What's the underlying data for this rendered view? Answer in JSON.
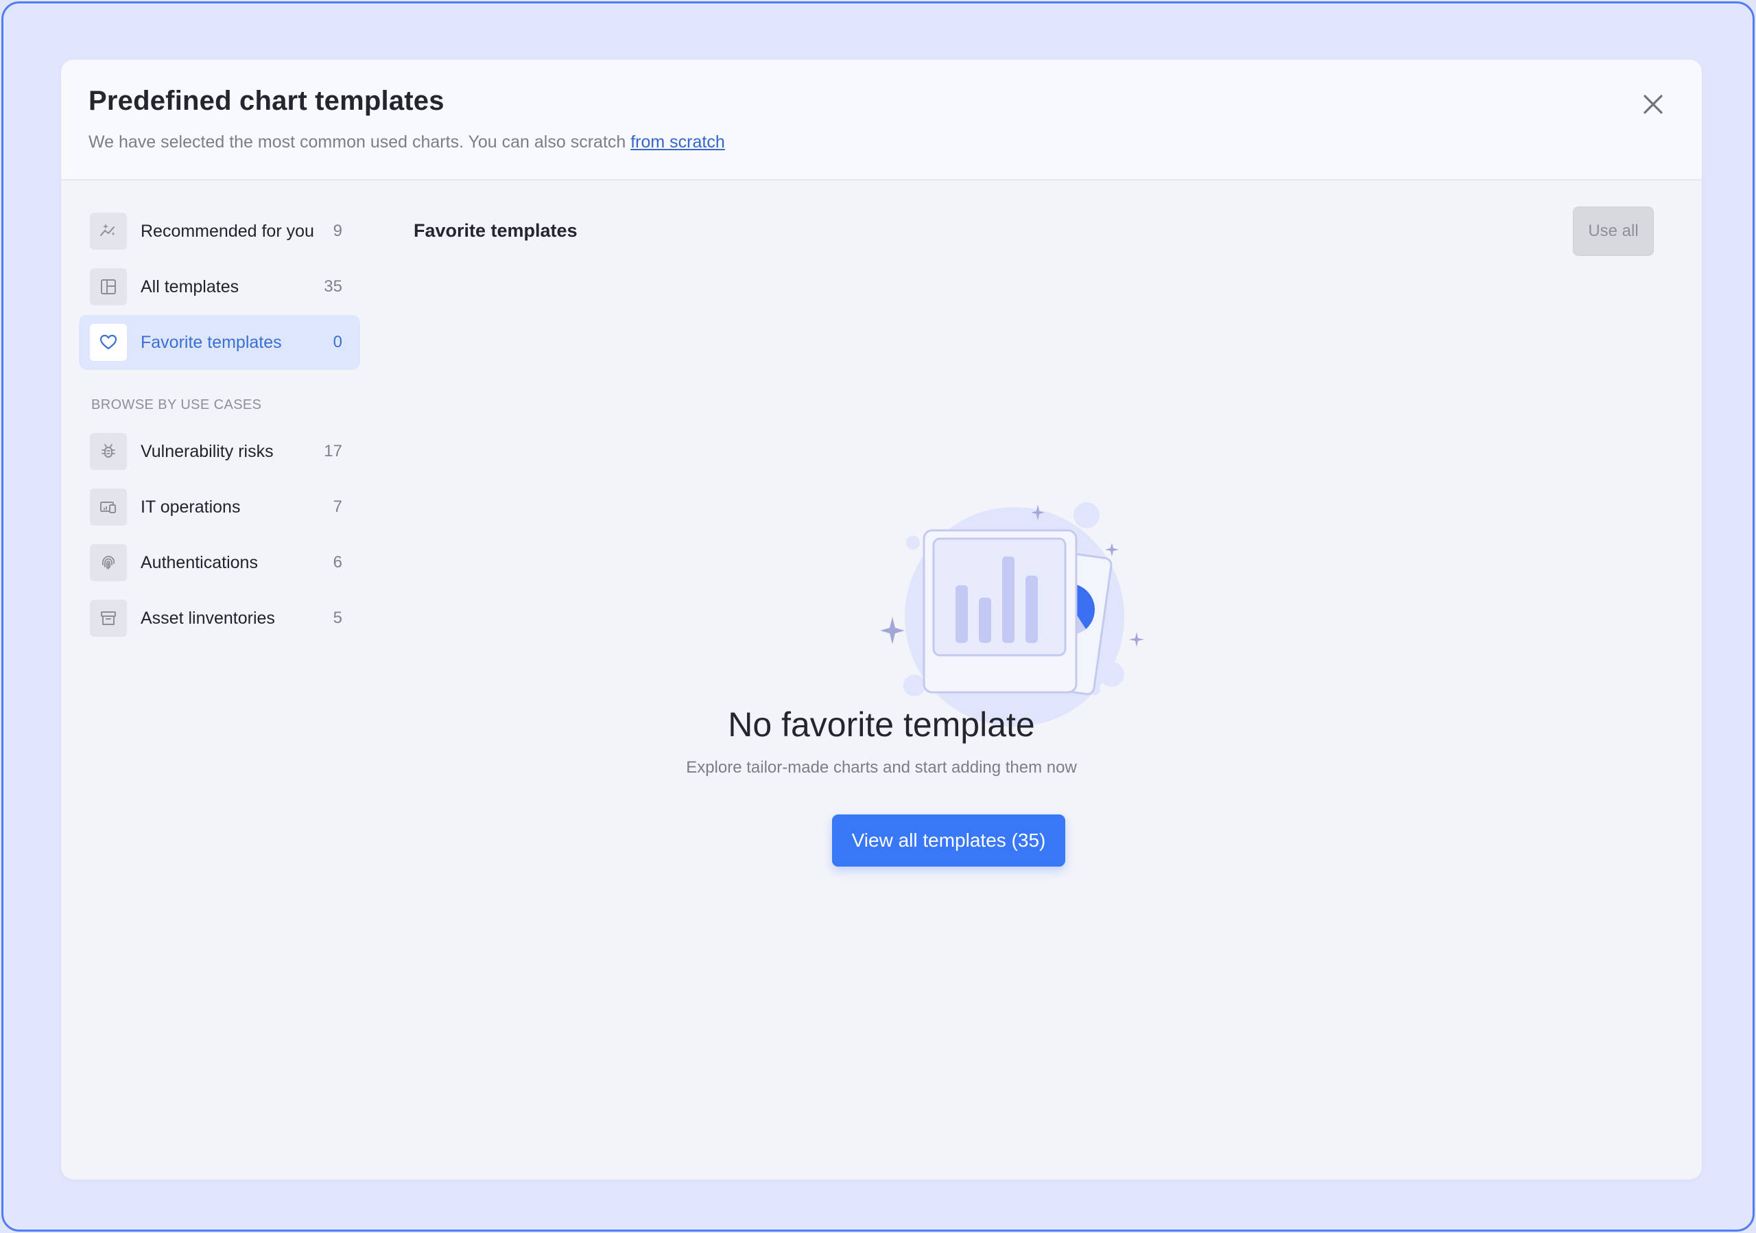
{
  "modal": {
    "title": "Predefined chart templates",
    "subtitle_prefix": "We have selected the most common used charts. You can also scratch ",
    "subtitle_link": "from scratch",
    "close_icon": "close-icon"
  },
  "sidebar": {
    "top_items": [
      {
        "label": "Recommended for you",
        "count": "9",
        "icon": "sparkle-chart-icon",
        "active": false
      },
      {
        "label": "All templates",
        "count": "35",
        "icon": "layout-icon",
        "active": false
      },
      {
        "label": "Favorite templates",
        "count": "0",
        "icon": "heart-icon",
        "active": true
      }
    ],
    "section_heading": "BROWSE BY USE CASES",
    "use_case_items": [
      {
        "label": "Vulnerability risks",
        "count": "17",
        "icon": "bug-icon"
      },
      {
        "label": "IT operations",
        "count": "7",
        "icon": "devices-icon"
      },
      {
        "label": "Authentications",
        "count": "6",
        "icon": "fingerprint-icon"
      },
      {
        "label": "Asset linventories",
        "count": "5",
        "icon": "archive-icon"
      }
    ]
  },
  "content": {
    "title": "Favorite templates",
    "use_all_label": "Use all",
    "empty_title": "No favorite template",
    "empty_description": "Explore tailor-made charts and start adding them now",
    "cta_label": "View all templates (35)"
  },
  "colors": {
    "accent": "#3877f5",
    "link": "#3366cc",
    "active_bg": "#dee6fb",
    "frame_border": "#4f7df3"
  }
}
